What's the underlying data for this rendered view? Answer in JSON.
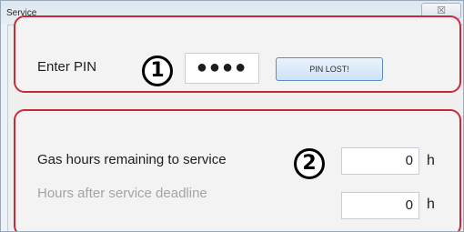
{
  "window": {
    "title": "Service",
    "close_glyph": "☒"
  },
  "pin_section": {
    "label": "Enter PIN",
    "badge": "1",
    "pin_value": "●●●●",
    "pin_lost_button": "PIN LOST!"
  },
  "service_section": {
    "badge": "2",
    "gas_hours": {
      "label": "Gas hours remaining to service",
      "value": "0",
      "unit": "h"
    },
    "hours_after_deadline": {
      "label": "Hours after service deadline",
      "value": "0",
      "unit": "h",
      "disabled": true
    }
  },
  "colors": {
    "highlight_border": "#c92a3a",
    "button_border": "#5a8ec4"
  }
}
